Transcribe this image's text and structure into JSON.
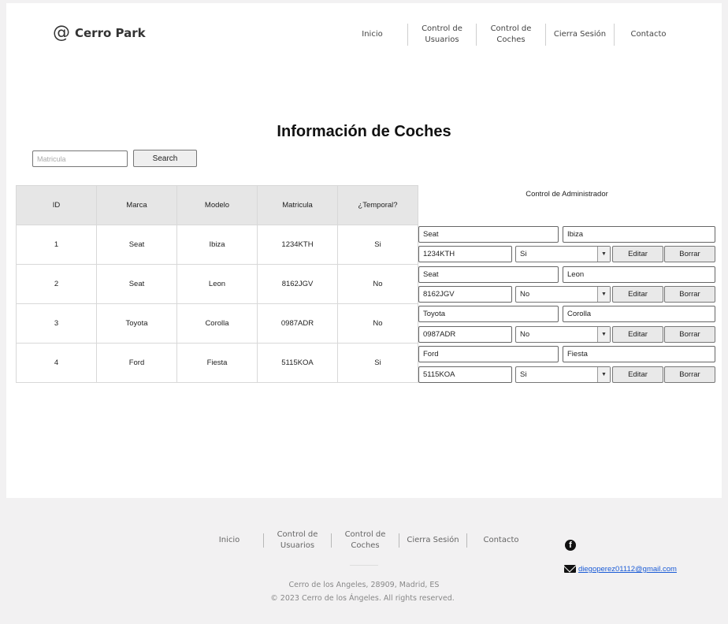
{
  "header": {
    "logo_icon": "@",
    "logo_text": "Cerro Park",
    "nav": [
      "Inicio",
      "Control de Usuarios",
      "Control de Coches",
      "Cierra Sesión",
      "Contacto"
    ]
  },
  "main": {
    "title": "Información de Coches",
    "search": {
      "placeholder": "Matricula",
      "button": "Search"
    },
    "table": {
      "headers": [
        "ID",
        "Marca",
        "Modelo",
        "Matricula",
        "¿Temporal?"
      ],
      "rows": [
        [
          "1",
          "Seat",
          "Ibiza",
          "1234KTH",
          "Si"
        ],
        [
          "2",
          "Seat",
          "Leon",
          "8162JGV",
          "No"
        ],
        [
          "3",
          "Toyota",
          "Corolla",
          "0987ADR",
          "No"
        ],
        [
          "4",
          "Ford",
          "Fiesta",
          "5115KOA",
          "Si"
        ]
      ]
    },
    "admin": {
      "title": "Control de Administrador",
      "edit_label": "Editar",
      "delete_label": "Borrar",
      "rows": [
        {
          "marca": "Seat",
          "modelo": "Ibiza",
          "matricula": "1234KTH",
          "temporal": "Si"
        },
        {
          "marca": "Seat",
          "modelo": "Leon",
          "matricula": "8162JGV",
          "temporal": "No"
        },
        {
          "marca": "Toyota",
          "modelo": "Corolla",
          "matricula": "0987ADR",
          "temporal": "No"
        },
        {
          "marca": "Ford",
          "modelo": "Fiesta",
          "matricula": "5115KOA",
          "temporal": "Si"
        }
      ]
    }
  },
  "footer": {
    "nav": [
      "Inicio",
      "Control de Usuarios",
      "Control de Coches",
      "Cierra Sesión",
      "Contacto"
    ],
    "address": "Cerro de los Angeles, 28909, Madrid, ES",
    "copyright": "© 2023 Cerro de los Ángeles.  All rights reserved.",
    "facebook_icon": "facebook-icon",
    "mail_icon": "mail-icon",
    "email": "diegoperez01112@gmail.com"
  }
}
